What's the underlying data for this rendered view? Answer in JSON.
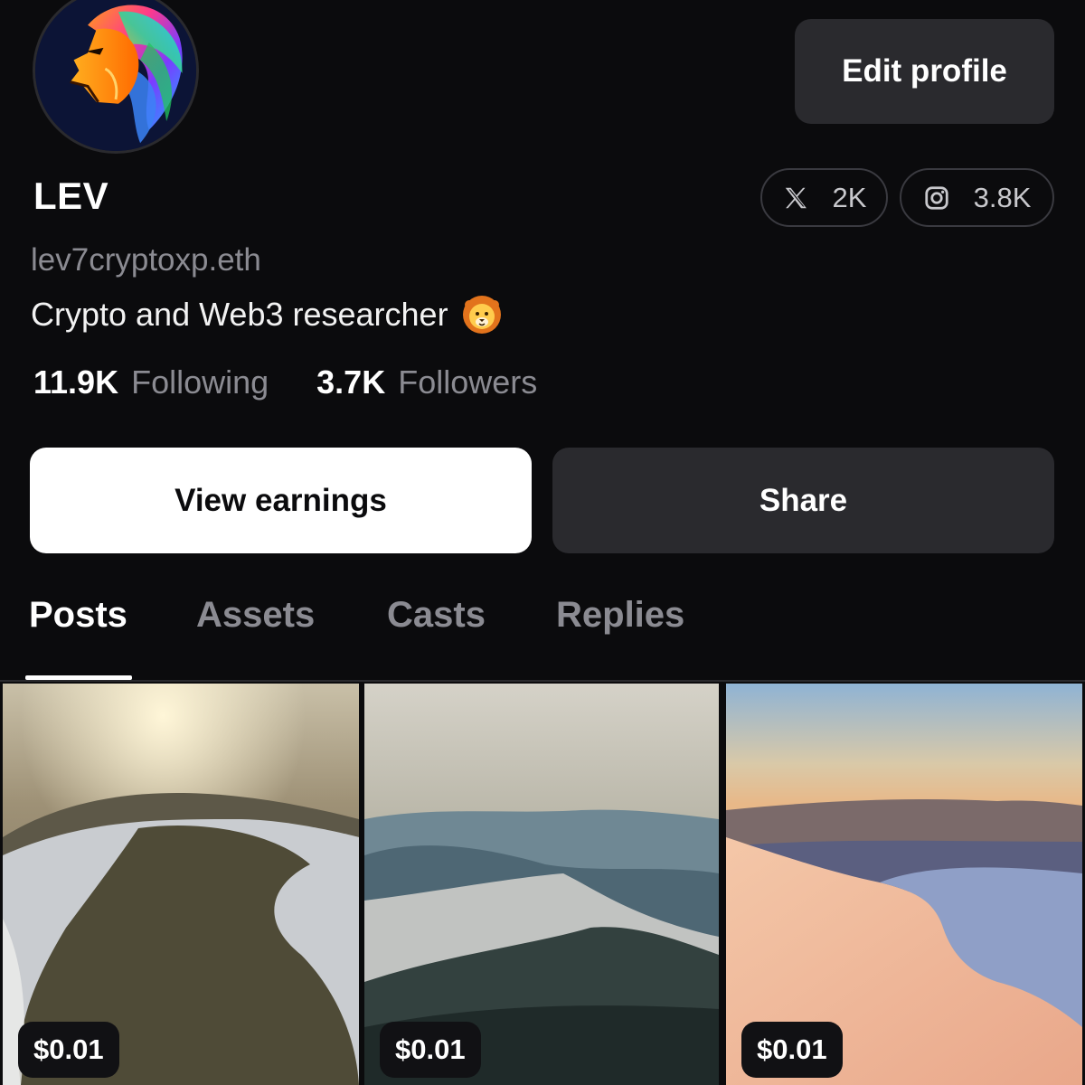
{
  "profile": {
    "display_name": "LEV",
    "handle": "lev7cryptoxp.eth",
    "bio": "Crypto and Web3 researcher",
    "bio_emoji": "lion-face-icon",
    "avatar": "lion-logo-avatar"
  },
  "header": {
    "edit_label": "Edit profile"
  },
  "socials": [
    {
      "platform": "x",
      "icon": "x-logo-icon",
      "count": "2K"
    },
    {
      "platform": "instagram",
      "icon": "instagram-icon",
      "count": "3.8K"
    }
  ],
  "stats": {
    "following": {
      "count": "11.9K",
      "label": "Following"
    },
    "followers": {
      "count": "3.7K",
      "label": "Followers"
    }
  },
  "actions": {
    "earnings_label": "View earnings",
    "share_label": "Share"
  },
  "tabs": [
    {
      "label": "Posts",
      "active": true
    },
    {
      "label": "Assets",
      "active": false
    },
    {
      "label": "Casts",
      "active": false
    },
    {
      "label": "Replies",
      "active": false
    }
  ],
  "posts": [
    {
      "price": "$0.01",
      "scene": "sunlit-snowy-mountain-lake"
    },
    {
      "price": "$0.01",
      "scene": "misty-forested-ridge"
    },
    {
      "price": "$0.01",
      "scene": "pink-sunset-snow-dune"
    }
  ],
  "colors": {
    "background": "#0b0b0d",
    "surface": "#2a2a2e",
    "muted_text": "#8b8b92",
    "primary_text": "#ffffff"
  }
}
